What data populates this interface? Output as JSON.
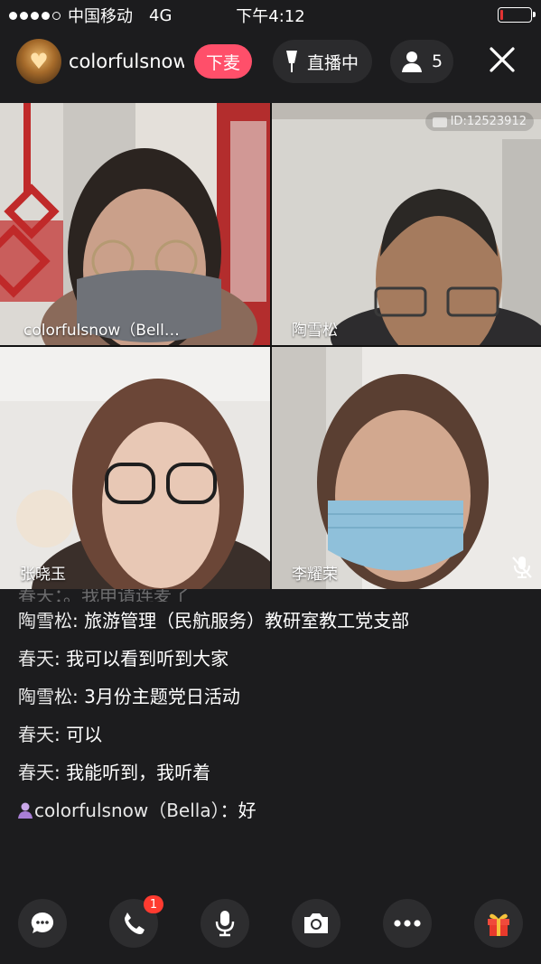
{
  "status_bar": {
    "carrier": "中国移动",
    "network": "4G",
    "time": "下午4:12",
    "battery_level": 0.1,
    "battery_color": "#e33333",
    "signal_bars_filled": 4
  },
  "header": {
    "host_name": "colorfulsnow",
    "leave_mic_label": "下麦",
    "live_label": "直播中",
    "viewer_count": "5",
    "accent_color": "#ff4f6a"
  },
  "video_tiles": [
    {
      "label": "colorfulsnow（Bell…"
    },
    {
      "label": "陶雪松",
      "room_id": "ID:12523912"
    },
    {
      "label": "张晓玉"
    },
    {
      "label": "李耀荣",
      "muted": true
    }
  ],
  "chat": {
    "partial_line": "春天：。我申请连麦了",
    "messages": [
      {
        "sender": "陶雪松",
        "text": "旅游管理（民航服务）教研室教工党支部"
      },
      {
        "sender": "春天",
        "text": "我可以看到听到大家"
      },
      {
        "sender": "陶雪松",
        "text": "3月份主题党日活动"
      },
      {
        "sender": "春天",
        "text": "可以"
      },
      {
        "sender": "春天",
        "text": "我能听到，我听着"
      },
      {
        "sender": "colorfulsnow（Bella）",
        "text": "好",
        "host": true
      }
    ]
  },
  "toolbar": {
    "items": [
      "chat-icon",
      "phone-icon",
      "microphone-icon",
      "camera-icon",
      "more-icon",
      "gift-icon"
    ],
    "phone_badge": "1"
  }
}
